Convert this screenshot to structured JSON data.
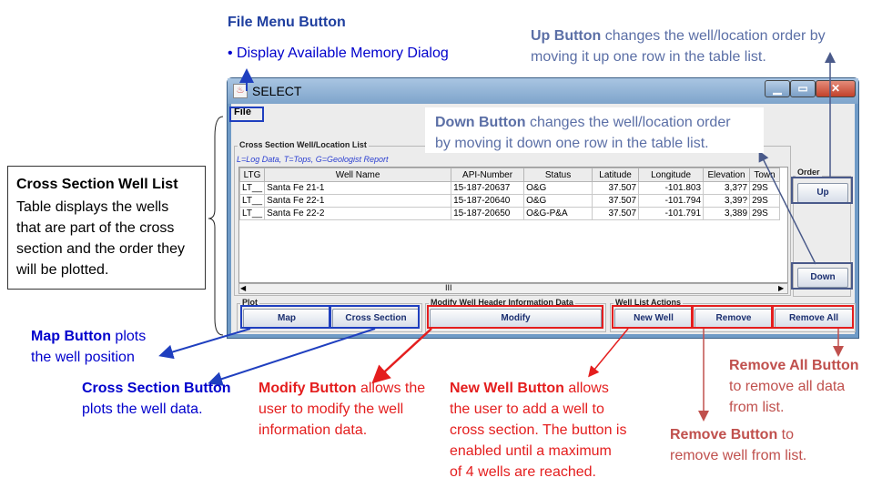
{
  "annotations": {
    "file_menu": {
      "title": "File Menu Button",
      "bullet": "• Display Available Memory Dialog"
    },
    "up": {
      "title": "Up Button",
      "line1_rest": " changes the well/location order by",
      "line2": "moving it up one row in the table list."
    },
    "down": {
      "title": "Down Button",
      "line1_rest": " changes the well/location order",
      "line2": "by moving it down one row in the table list."
    },
    "well_list": {
      "title": "Cross Section Well List",
      "body": "Table displays the wells that are part of the cross section and the order they will be plotted."
    },
    "map": {
      "title": "Map Button",
      "line1_rest": " plots",
      "line2": "the well position"
    },
    "cross_section": {
      "title": "Cross Section Button",
      "line2": "plots the  well data."
    },
    "modify": {
      "title": "Modify Button",
      "line1_rest": " allows the",
      "line2": "user to modify the well",
      "line3": "information data."
    },
    "new_well": {
      "title": "New Well Button",
      "line1_rest": " allows",
      "line2": "the user to add a well to",
      "line3": "cross section.  The button is",
      "line4": "enabled until a maximum",
      "line5": "of 4 wells are reached."
    },
    "remove_all": {
      "title": "Remove All Button",
      "line2": "to remove all data",
      "line3": "from list."
    },
    "remove": {
      "title": "Remove Button",
      "line1_rest": " to",
      "line2": "remove well  from list."
    }
  },
  "window": {
    "title": "SELECT",
    "menu": {
      "file": "File"
    },
    "well_list_group": "Cross Section Well/Location List",
    "legend": "L=Log Data, T=Tops, G=Geologist Report",
    "order_group": "Order",
    "up_label": "Up",
    "down_label": "Down",
    "plot_group": "Plot",
    "map_label": "Map",
    "cross_section_label": "Cross Section",
    "modify_group": "Modify Well Header Information Data",
    "modify_label": "Modify",
    "actions_group": "Well List Actions",
    "new_well_label": "New Well",
    "remove_label": "Remove",
    "remove_all_label": "Remove All",
    "scroll_thumb": "III"
  },
  "table": {
    "columns": [
      "LTG",
      "Well Name",
      "API-Number",
      "Status",
      "Latitude",
      "Longitude",
      "Elevation",
      "Town"
    ],
    "rows": [
      [
        "LT__",
        "Santa Fe 21-1",
        "15-187-20637",
        "O&G",
        "37.507",
        "-101.803",
        "3,3?7",
        "29S"
      ],
      [
        "LT__",
        "Santa Fe 22-1",
        "15-187-20640",
        "O&G",
        "37.507",
        "-101.794",
        "3,39?",
        "29S"
      ],
      [
        "LT__",
        "Santa Fe 22-2",
        "15-187-20650",
        "O&G-P&A",
        "37.507",
        "-101.791",
        "3,389",
        "29S"
      ]
    ]
  },
  "colors": {
    "blue_callout": "#0000cc",
    "red_callout": "#e41e1e",
    "brown_callout": "#c0504d",
    "slate_callout": "#5b6fa6"
  }
}
